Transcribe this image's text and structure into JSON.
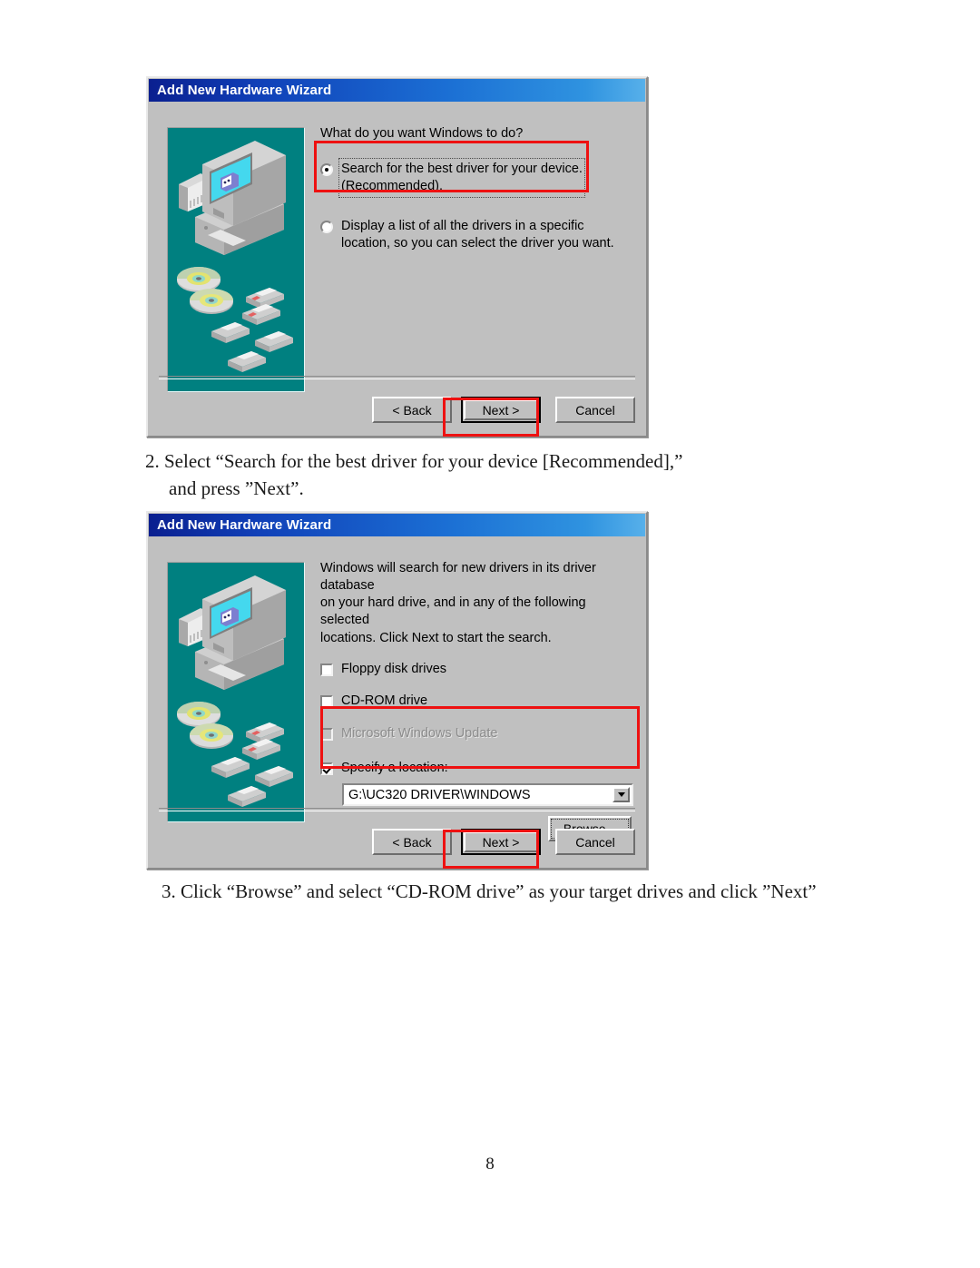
{
  "document": {
    "page_number": "8"
  },
  "dialog1": {
    "title": "Add New Hardware Wizard",
    "prompt": "What do you want Windows to do?",
    "options": [
      {
        "label": "Search for the best driver for your device.\n(Recommended).",
        "selected": true,
        "highlighted": true
      },
      {
        "label": "Display a list of all the drivers in a specific\nlocation, so you can select the driver you want.",
        "selected": false,
        "highlighted": false
      }
    ],
    "buttons": {
      "back": "< Back",
      "next": "Next >",
      "cancel": "Cancel"
    },
    "illustration": "computer-cds-floppies-illustration"
  },
  "dialog2": {
    "title": "Add New Hardware Wizard",
    "description": "Windows will search for new drivers in its driver database\non your hard drive, and in any of the following selected\nlocations. Click Next to start the search.",
    "checkboxes": [
      {
        "label": "Floppy disk drives",
        "checked": false,
        "disabled": false
      },
      {
        "label": "CD-ROM drive",
        "checked": false,
        "disabled": false
      },
      {
        "label": "Microsoft Windows Update",
        "checked": false,
        "disabled": true
      },
      {
        "label": "Specify a location:",
        "checked": true,
        "disabled": false
      }
    ],
    "location_value": "G:\\UC320 DRIVER\\WINDOWS",
    "browse_label": "Browse...",
    "buttons": {
      "back": "< Back",
      "next": "Next >",
      "cancel": "Cancel"
    },
    "illustration": "computer-cds-floppies-illustration"
  },
  "instructions": {
    "step2_line1": "2. Select “Search for the best driver for your device [Recommended],”",
    "step2_line2": "and press ”Next”.",
    "step3": "3. Click “Browse” and select “CD-ROM drive” as your target drives and click ”Next”"
  },
  "colors": {
    "titlebar_blue": "#0a1f8f",
    "dialog_face": "#c0c0c0",
    "illustration_teal": "#008080",
    "highlight_red": "#ee1111",
    "screen_cyan": "#44d8ee"
  }
}
